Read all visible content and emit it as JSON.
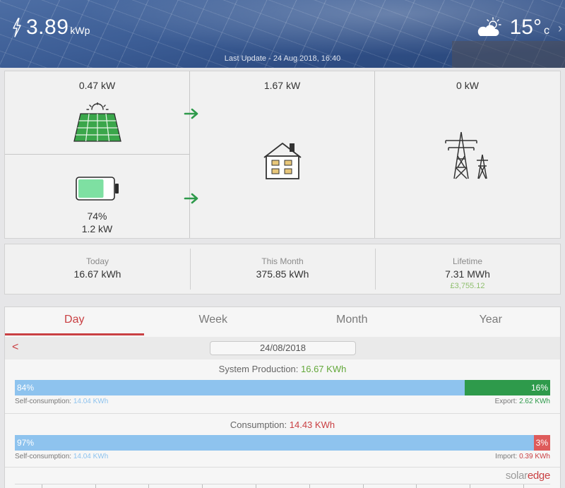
{
  "header": {
    "power_value": "3.89",
    "power_unit": "kWp",
    "temperature": "15°",
    "temperature_unit": "c",
    "last_update": "Last Update - 24 Aug 2018, 16:40"
  },
  "flow": {
    "pv_power": "0.47 kW",
    "home_power": "1.67 kW",
    "grid_power": "0 kW",
    "battery_percent": "74%",
    "battery_level": 0.74,
    "battery_power": "1.2 kW"
  },
  "stats": {
    "today_label": "Today",
    "today_value": "16.67 kWh",
    "month_label": "This Month",
    "month_value": "375.85 kWh",
    "lifetime_label": "Lifetime",
    "lifetime_value": "7.31 MWh",
    "lifetime_money": "£3,755.12"
  },
  "tabs": [
    "Day",
    "Week",
    "Month",
    "Year"
  ],
  "active_tab": "Day",
  "date": {
    "prev": "<",
    "current": "24/08/2018"
  },
  "production": {
    "label": "System Production: ",
    "value": "16.67 KWh",
    "self_percent": "84%",
    "self_fraction": 0.84,
    "export_percent": "16%",
    "self_label": "Self-consumption: ",
    "self_value": "14.04 KWh",
    "export_label": "Export: ",
    "export_value": "2.62 KWh"
  },
  "consumption": {
    "label": "Consumption: ",
    "value": "14.43 KWh",
    "self_percent": "97%",
    "self_fraction": 0.97,
    "import_percent": "3%",
    "self_label": "Self-consumption: ",
    "self_value": "14.04 KWh",
    "import_label": "Import: ",
    "import_value": "0.39 KWh"
  },
  "brand": {
    "part1": "solar",
    "part2": "edge"
  },
  "colors": {
    "accent_red": "#c94043",
    "arrow_green": "#2e9a4b",
    "self_blue": "#8ec3ee",
    "export_green": "#2e9a4b",
    "import_red": "#de5b5b"
  }
}
